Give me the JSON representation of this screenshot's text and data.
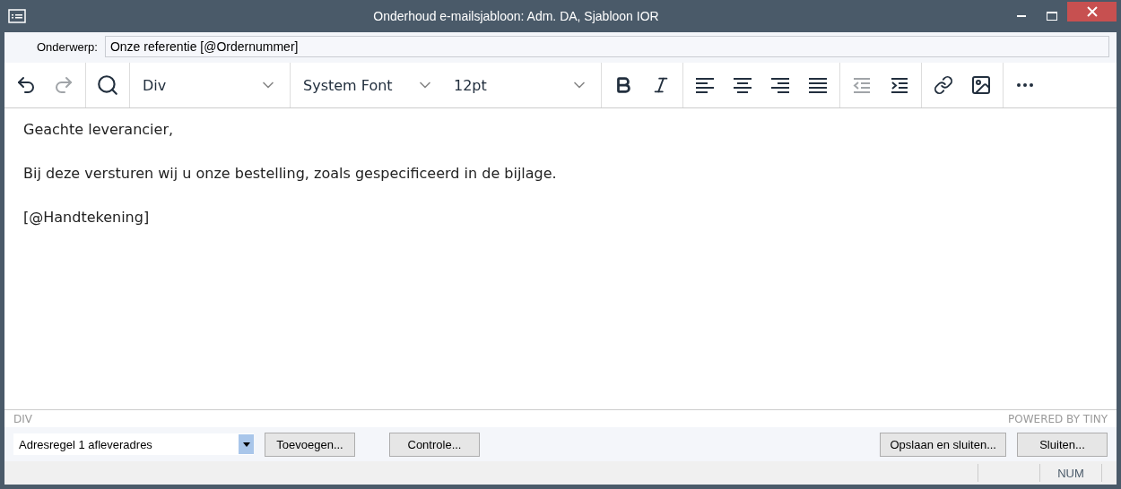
{
  "window": {
    "title": "Onderhoud e-mailsjabloon: Adm. DA, Sjabloon IOR"
  },
  "subject": {
    "label": "Onderwerp:",
    "value": "Onze referentie [@Ordernummer]"
  },
  "toolbar": {
    "groups": [
      {
        "items": [
          {
            "kind": "undo",
            "disabled": false
          },
          {
            "kind": "redo",
            "disabled": true
          }
        ]
      },
      {
        "items": [
          {
            "kind": "search",
            "disabled": false
          }
        ]
      },
      {
        "dropdowns": [
          {
            "value": "Div"
          }
        ]
      },
      {
        "dropdowns": [
          {
            "value": "System Font"
          },
          {
            "value": "12pt"
          }
        ]
      },
      {
        "items": [
          {
            "kind": "bold",
            "disabled": false
          },
          {
            "kind": "italic",
            "disabled": false
          }
        ]
      },
      {
        "items": [
          {
            "kind": "align-left",
            "disabled": false
          },
          {
            "kind": "align-center",
            "disabled": false
          },
          {
            "kind": "align-right",
            "disabled": false
          },
          {
            "kind": "align-justify",
            "disabled": false
          }
        ]
      },
      {
        "items": [
          {
            "kind": "outdent",
            "disabled": true
          },
          {
            "kind": "indent",
            "disabled": false
          }
        ]
      },
      {
        "items": [
          {
            "kind": "link",
            "disabled": false
          },
          {
            "kind": "image",
            "disabled": false
          }
        ]
      },
      {
        "items": [
          {
            "kind": "more",
            "disabled": false
          }
        ]
      }
    ]
  },
  "editor": {
    "paragraphs": [
      "Geachte leverancier,",
      "Bij deze versturen wij u onze bestelling, zoals gespecificeerd in de bijlage.",
      "[@Handtekening]"
    ]
  },
  "editor_status": {
    "path": "DIV",
    "branding": "POWERED BY TINY"
  },
  "field_select": {
    "value": "Adresregel 1 afleveradres"
  },
  "buttons_left": [
    "Toevoegen...",
    "Controle..."
  ],
  "buttons_right": [
    "Opslaan en sluiten...",
    "Sluiten..."
  ],
  "status_bar": {
    "panels": [
      "NUM"
    ]
  }
}
